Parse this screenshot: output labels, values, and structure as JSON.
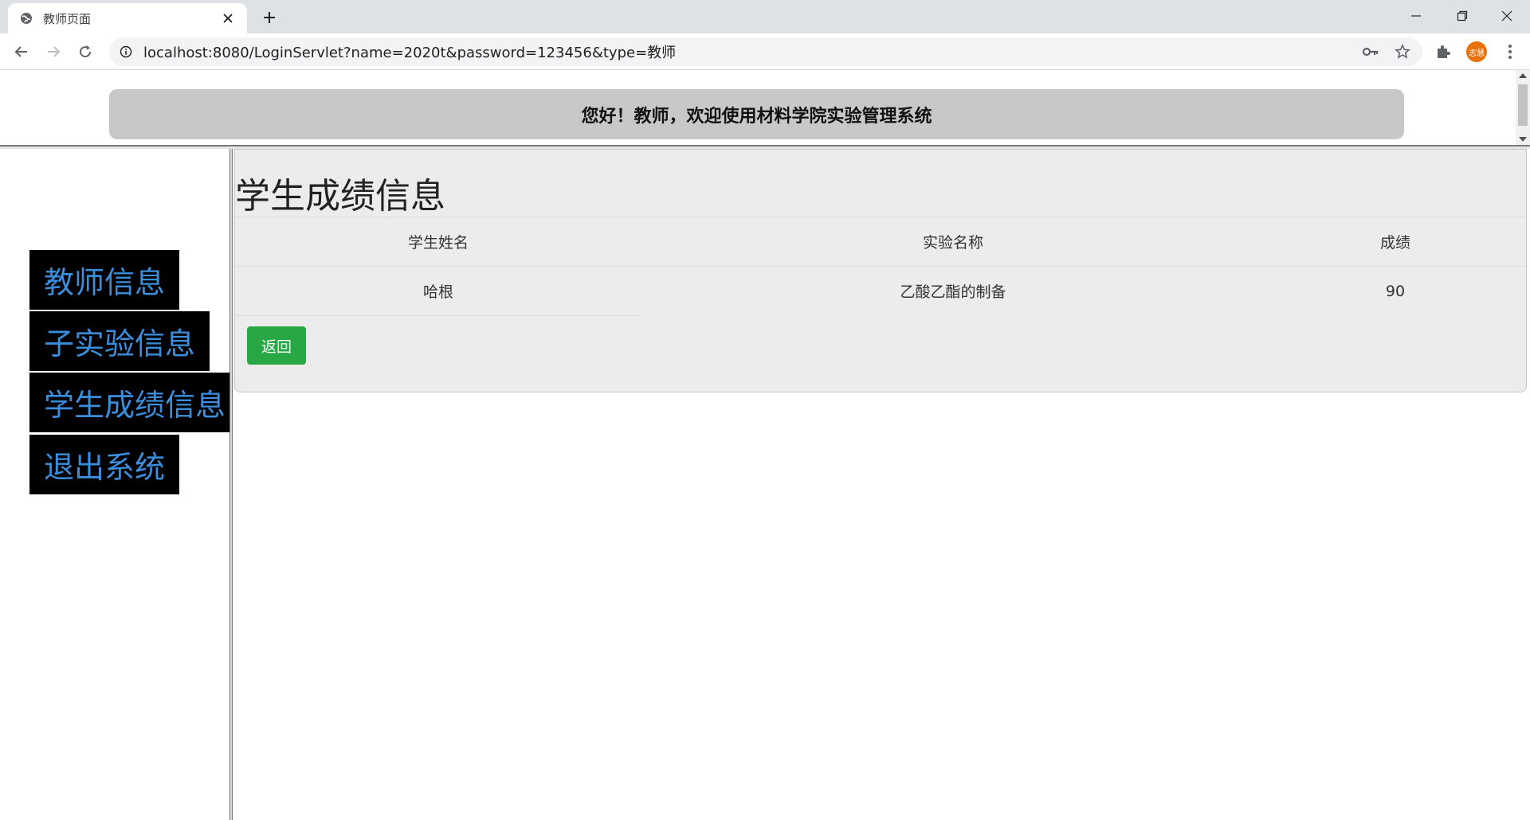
{
  "browser": {
    "tab_title": "教师页面",
    "url": "localhost:8080/LoginServlet?name=2020t&password=123456&type=教师",
    "avatar_text": "志慧",
    "icons": [
      "globe-icon",
      "close-icon",
      "plus-icon",
      "back-arrow-icon",
      "forward-arrow-icon",
      "reload-icon",
      "info-icon",
      "key-icon",
      "star-icon",
      "puzzle-icon",
      "kebab-menu-icon"
    ]
  },
  "header": {
    "welcome": "您好！教师，欢迎使用材料学院实验管理系统"
  },
  "sidebar": {
    "items": [
      {
        "label": "教师信息"
      },
      {
        "label": "子实验信息"
      },
      {
        "label": "学生成绩信息"
      },
      {
        "label": "退出系统"
      }
    ]
  },
  "main": {
    "title": "学生成绩信息",
    "columns": [
      "学生姓名",
      "实验名称",
      "成绩"
    ],
    "rows": [
      {
        "student": "哈根",
        "experiment": "乙酸乙酯的制备",
        "score": "90"
      }
    ],
    "back_label": "返回"
  },
  "colors": {
    "menu_bg": "#000000",
    "menu_text": "#3b8edb",
    "banner_bg": "#c8c8c8",
    "panel_bg": "#ececec",
    "button_green": "#28a745",
    "avatar": "#e8710a"
  }
}
